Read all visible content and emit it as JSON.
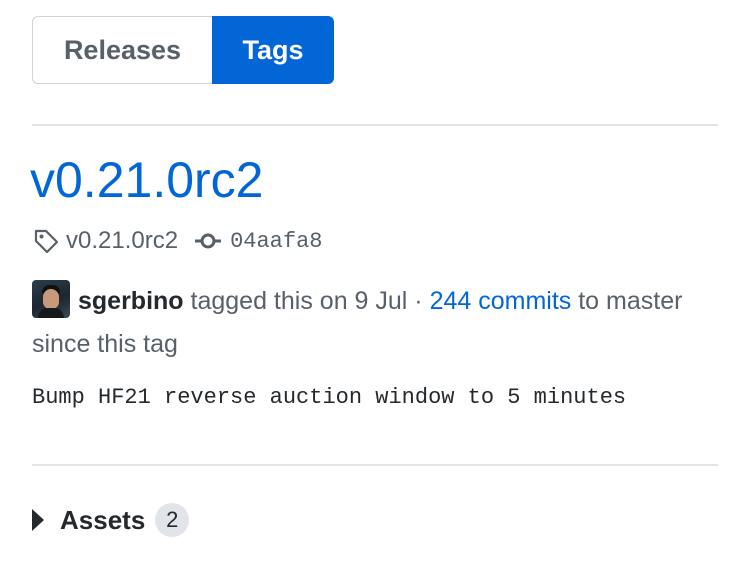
{
  "tabs": {
    "releases_label": "Releases",
    "tags_label": "Tags",
    "active": "Tags"
  },
  "release": {
    "title": "v0.21.0rc2",
    "tag_name": "v0.21.0rc2",
    "commit_sha": "04aafa8",
    "author": "sgerbino",
    "action_text": " tagged this on 9 Jul · ",
    "commits_link": "244 commits",
    "commits_suffix": " to master since this tag",
    "description": "Bump HF21 reverse auction window to 5 minutes"
  },
  "assets": {
    "label": "Assets",
    "count": "2"
  },
  "icons": {
    "tag": "tag-icon",
    "commit": "git-commit-icon",
    "expand": "triangle-right-icon"
  },
  "colors": {
    "link": "#0366d6",
    "active_tab_bg": "#0366d6",
    "muted_text": "#586069",
    "divider": "#e1e4e8"
  }
}
